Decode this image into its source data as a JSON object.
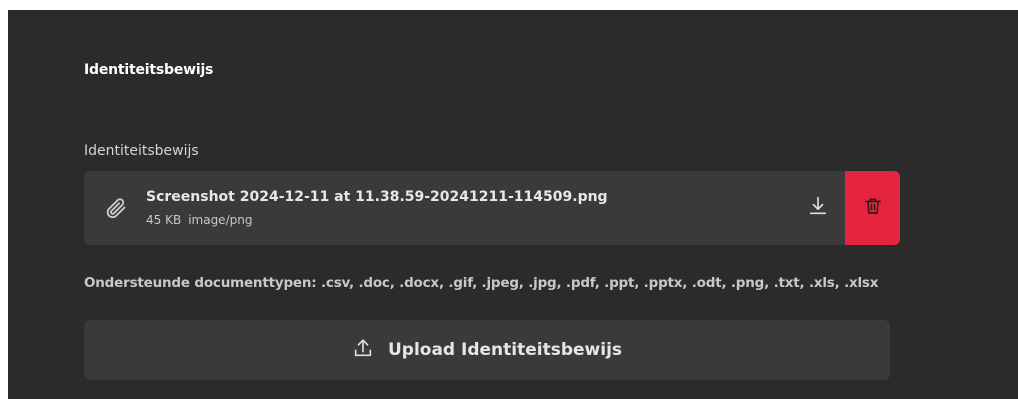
{
  "section": {
    "title": "Identiteitsbewijs"
  },
  "field": {
    "label": "Identiteitsbewijs"
  },
  "file": {
    "name": "Screenshot 2024-12-11 at 11.38.59-20241211-114509.png",
    "size": "45 KB",
    "type": "image/png",
    "icon": "paperclip-icon",
    "download_icon": "download-icon",
    "delete_icon": "trash-icon"
  },
  "supported_types": "Ondersteunde documenttypen: .csv, .doc, .docx, .gif, .jpeg, .jpg, .pdf, .ppt, .pptx, .odt, .png, .txt, .xls, .xlsx",
  "upload": {
    "label": "Upload Identiteitsbewijs",
    "icon": "upload-icon"
  },
  "colors": {
    "background": "#2b2b2b",
    "card": "#3a3a3a",
    "danger": "#e5243f",
    "text": "#e8e8e8"
  }
}
